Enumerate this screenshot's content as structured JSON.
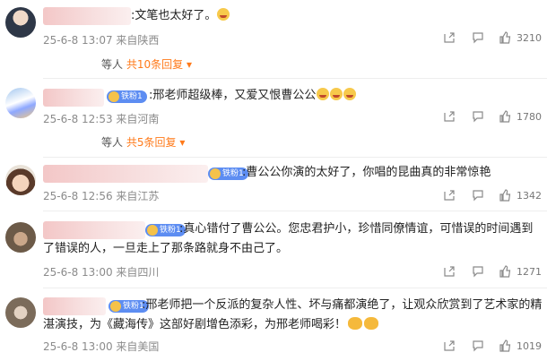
{
  "comments": [
    {
      "name_suffix": ":",
      "text": ":文笔也太好了。",
      "emojis": [
        "crying-face-emoji"
      ],
      "timestamp": "25-6-8 13:07 来自陕西",
      "likes": "3210",
      "replies_prefix": "等人",
      "replies_text": "共10条回复"
    },
    {
      "badge": "铁粉1",
      "text": ":邢老师超级棒，又爱又恨曹公公",
      "emojis": [
        "crying-face-emoji",
        "crying-face-emoji",
        "crying-face-emoji"
      ],
      "timestamp": "25-6-8 12:53 来自河南",
      "likes": "1780",
      "replies_prefix": "等人",
      "replies_text": "共5条回复"
    },
    {
      "badge": "铁粉1",
      "text": ":曹公公你演的太好了，你唱的昆曲真的非常惊艳",
      "timestamp": "25-6-8 12:56 来自江苏",
      "likes": "1342"
    },
    {
      "badge": "铁粉1",
      "text": ":真心错付了曹公公。您忠君护小，珍惜同僚情谊，可惜误的时间遇到了错误的人，一旦走上了那条路就身不由己了。",
      "timestamp": "25-6-8 13:00 来自四川",
      "likes": "1271"
    },
    {
      "badge": "铁粉1",
      "text": ":邢老师把一个反派的复杂人性、坏与痛都演绝了，让观众欣赏到了艺术家的精湛演技，为《藏海传》这部好剧增色添彩，为邢老师喝彩！",
      "emojis": [
        "clap-emoji",
        "clap-emoji"
      ],
      "timestamp": "25-6-8 13:00 来自美国",
      "likes": "1019"
    }
  ],
  "colors": {
    "accent_orange": "#ff7a1a",
    "badge_blue": "#5d8df2",
    "meta_gray": "#8b8b8b"
  },
  "icons": {
    "share": "share-icon",
    "comment": "comment-icon",
    "like": "thumbs-up-icon",
    "expand": "chevron-down-icon"
  }
}
